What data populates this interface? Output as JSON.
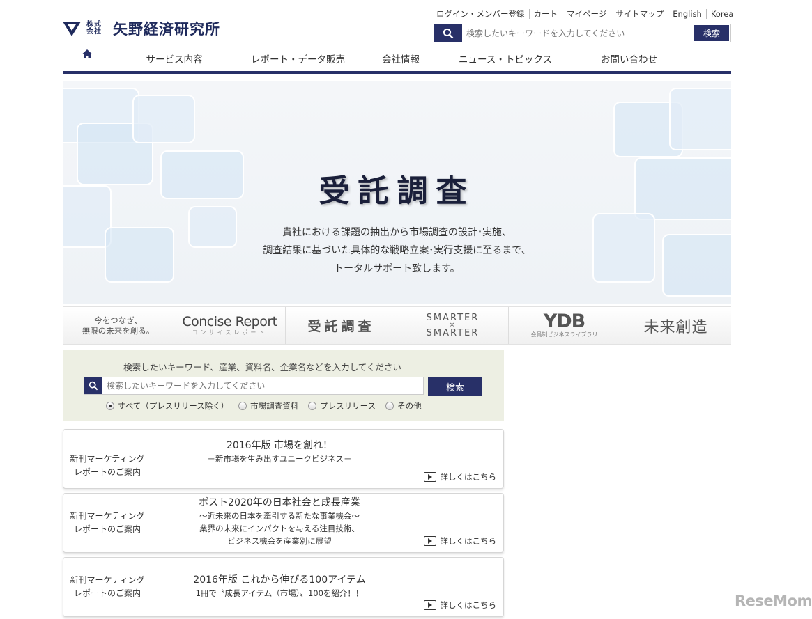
{
  "header": {
    "logo_small": "株式会社",
    "logo_name": "矢野経済研究所",
    "util_links": [
      "ログイン・メンバー登録",
      "カート",
      "マイページ",
      "サイトマップ",
      "English",
      "Korea"
    ],
    "search_placeholder": "検索したいキーワードを入力してください",
    "search_button": "検索"
  },
  "nav": {
    "items": [
      "サービス内容",
      "レポート・データ販売",
      "会社情報",
      "ニュース・トピックス",
      "お問い合わせ"
    ]
  },
  "hero": {
    "title": "受託調査",
    "lines": [
      "貴社における課題の抽出から市場調査の設計･実施、",
      "調査結果に基づいた具体的な戦略立案･実行支援に至るまで、",
      "トータルサポート致します。"
    ]
  },
  "banners": {
    "b1_line1": "今をつなぎ、",
    "b1_line2": "無限の未来を創る。",
    "b2_title": "Concise Report",
    "b2_sub": "コンサイスレポート",
    "b3_title": "受託調査",
    "b4_top": "SMARTER",
    "b4_x": "×",
    "b4_bottom": "SMARTER",
    "b5_title": "YDB",
    "b5_sub": "会員制ビジネスライブラリ",
    "b6_title": "未来創造"
  },
  "search": {
    "guide": "検索したいキーワード、産業、資料名、企業名などを入力してください",
    "placeholder": "検索したいキーワードを入力してください",
    "button": "検索",
    "options": [
      "すべて（プレスリリース除く）",
      "市場調査資料",
      "プレスリリース",
      "その他"
    ],
    "selected_index": 0
  },
  "cards": [
    {
      "cat1": "新刊マーケティング",
      "cat2": "レポートのご案内",
      "title": "2016年版 市場を創れ！",
      "sub1": "－新市場を生み出すユニークビジネス－",
      "sub2": "",
      "sub3": "",
      "more": "詳しくはこちら"
    },
    {
      "cat1": "新刊マーケティング",
      "cat2": "レポートのご案内",
      "title": "ポスト2020年の日本社会と成長産業",
      "sub1": "～近未来の日本を牽引する新たな事業機会～",
      "sub2": "業界の未来にインパクトを与える注目技術、",
      "sub3": "ビジネス機会を産業別に展望",
      "more": "詳しくはこちら"
    },
    {
      "cat1": "新刊マーケティング",
      "cat2": "レポートのご案内",
      "title": "2016年版 これから伸びる100アイテム",
      "sub1": "1冊で〝成長アイテム（市場）〟100を紹介！！",
      "sub2": "",
      "sub3": "",
      "more": "詳しくはこちら"
    }
  ],
  "watermark": "ReseMom"
}
